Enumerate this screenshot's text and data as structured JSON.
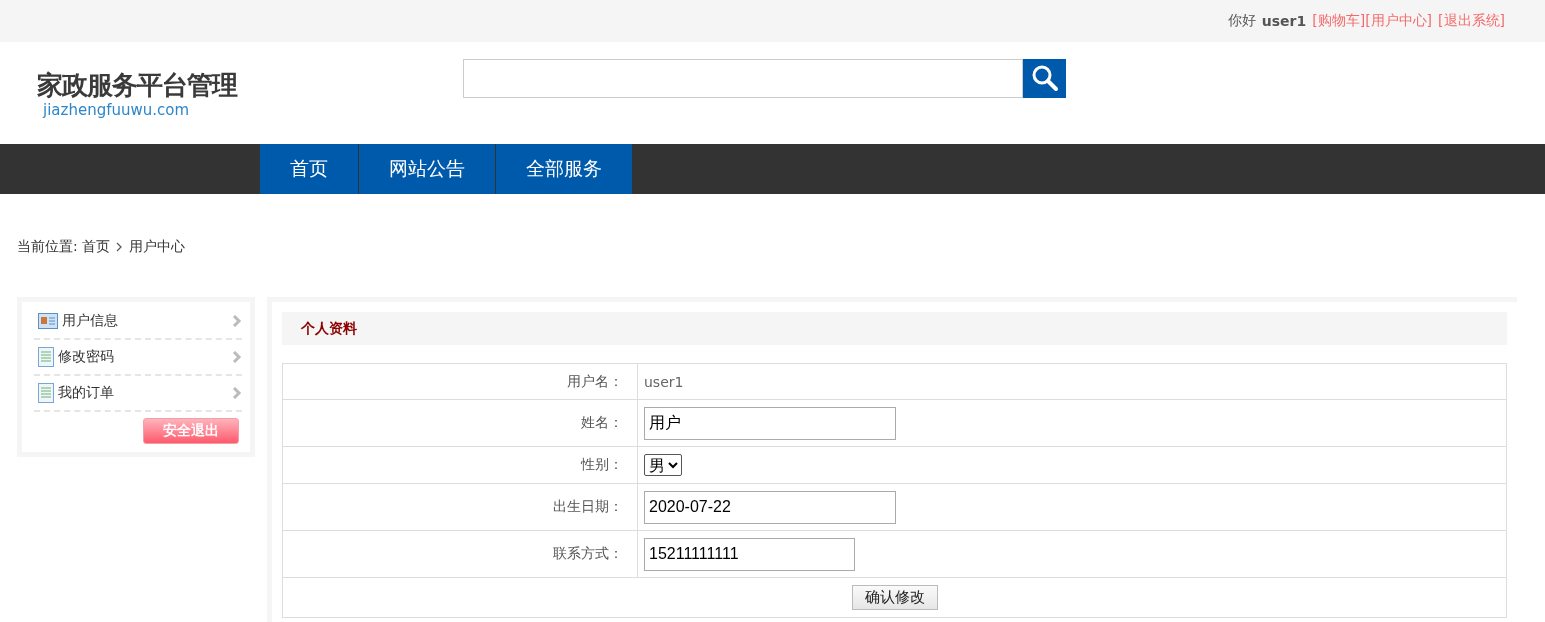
{
  "top_bar": {
    "greeting": "你好",
    "username": "user1",
    "links": [
      "[购物车]",
      "[用户中心]",
      "[退出系统]"
    ]
  },
  "logo": {
    "title": "家政服务平台管理",
    "domain": "jiazhengfuuwu.com"
  },
  "nav": [
    {
      "label": "首页"
    },
    {
      "label": "网站公告"
    },
    {
      "label": "全部服务"
    }
  ],
  "breadcrumb": {
    "label": "当前位置:",
    "items": [
      "首页",
      "用户中心"
    ]
  },
  "sidebar": {
    "items": [
      {
        "label": "用户信息",
        "kind": "card"
      },
      {
        "label": "修改密码",
        "kind": "document"
      },
      {
        "label": "我的订单",
        "kind": "document"
      }
    ],
    "logout": "安全退出"
  },
  "panel": {
    "title": "个人资料",
    "rows": [
      {
        "kind": "text",
        "label": "用户名：",
        "value": "user1"
      },
      {
        "kind": "input",
        "label": "姓名：",
        "value": "用户"
      },
      {
        "kind": "select",
        "label": "性别：",
        "value": "男"
      },
      {
        "kind": "input",
        "label": "出生日期：",
        "value": "2020-07-22"
      },
      {
        "kind": "input-short",
        "label": "联系方式：",
        "value": "15211111111"
      }
    ],
    "submit": "确认修改"
  }
}
